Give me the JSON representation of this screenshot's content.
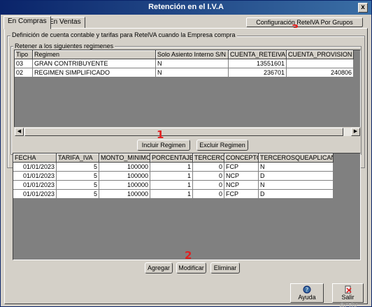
{
  "window": {
    "title": "Retención en el I.V.A",
    "close_glyph": "x"
  },
  "tabs": [
    {
      "label": "En Compras",
      "active": true
    },
    {
      "label": "En Ventas",
      "active": false
    }
  ],
  "config_button": {
    "label": "Configuración RetelVA Por Grupos"
  },
  "group_main": {
    "label": "Definición de cuenta contable y tarifas para RetelVA cuando la Empresa compra"
  },
  "group_regimes": {
    "label": "Retener a los siguientes regimenes"
  },
  "regimes_grid": {
    "headers": [
      "Tipo",
      "Regimen",
      "Solo Asiento Interno S/N",
      "CUENTA_RETEIVA",
      "CUENTA_PROVISION"
    ],
    "rows": [
      [
        "03",
        "GRAN CONTRIBUYENTE",
        "N",
        "13551601",
        ""
      ],
      [
        "02",
        "REGIMEN SIMPLIFICADO",
        "N",
        "236701",
        "240806"
      ]
    ]
  },
  "regime_buttons": {
    "include": "Incluir Regimen",
    "exclude": "Excluir Regimen"
  },
  "tariffs_grid": {
    "headers": [
      "FECHA",
      "TARIFA_IVA",
      "MONTO_MINIMO",
      "PORCENTAJE",
      "TERCERO",
      "CONCEPTO",
      "TERCEROSQUEAPLICAN"
    ],
    "rows": [
      [
        "01/01/2023",
        "5",
        "100000",
        "1",
        "0",
        "FCP",
        "N"
      ],
      [
        "01/01/2023",
        "5",
        "100000",
        "1",
        "0",
        "NCP",
        "D"
      ],
      [
        "01/01/2023",
        "5",
        "100000",
        "1",
        "0",
        "NCP",
        "N"
      ],
      [
        "01/01/2023",
        "5",
        "100000",
        "1",
        "0",
        "FCP",
        "D"
      ]
    ]
  },
  "tariff_buttons": {
    "add": "Agregar",
    "modify": "Modificar",
    "delete": "Eliminar"
  },
  "footer_buttons": {
    "help": "Ayuda",
    "exit": "Salir"
  },
  "markers": {
    "m1": "1",
    "m2": "2",
    "m3": "3"
  },
  "watermark": "Activ",
  "colors": {
    "titlebar": "#0a246a",
    "marker": "#e02020",
    "face": "#d4d0c8"
  }
}
